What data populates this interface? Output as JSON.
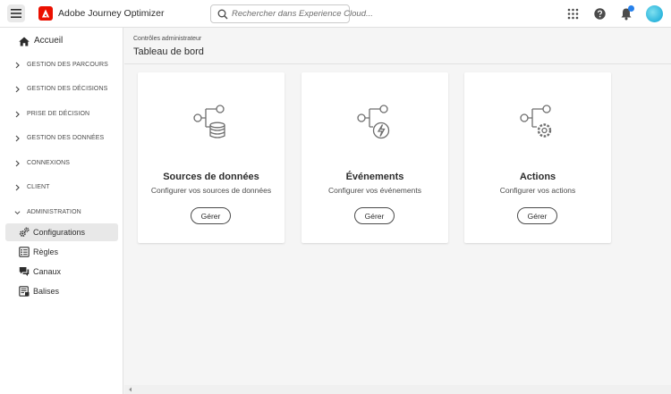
{
  "header": {
    "app_title": "Adobe Journey Optimizer",
    "search_placeholder": "Rechercher dans Experience Cloud...",
    "icons": [
      "menu-icon",
      "adobe-logo",
      "search-icon",
      "apps-grid-icon",
      "help-icon",
      "bell-icon",
      "avatar"
    ],
    "accent_color": "#eb1000"
  },
  "sidebar": {
    "home": "Accueil",
    "sections": [
      {
        "label": "GESTION DES PARCOURS",
        "expanded": false
      },
      {
        "label": "GESTION DES DÉCISIONS",
        "expanded": false
      },
      {
        "label": "PRISE DE DÉCISION",
        "expanded": false
      },
      {
        "label": "GESTION DES DONNÉES",
        "expanded": false
      },
      {
        "label": "CONNEXIONS",
        "expanded": false
      },
      {
        "label": "CLIENT",
        "expanded": false
      },
      {
        "label": "ADMINISTRATION",
        "expanded": true
      }
    ],
    "admin_items": [
      {
        "label": "Configurations",
        "icon": "gears-icon",
        "active": true
      },
      {
        "label": "Règles",
        "icon": "rules-list-icon",
        "active": false
      },
      {
        "label": "Canaux",
        "icon": "channels-icon",
        "active": false
      },
      {
        "label": "Balises",
        "icon": "tags-list-icon",
        "active": false
      }
    ]
  },
  "main": {
    "breadcrumb": "Contrôles administrateur",
    "title": "Tableau de bord",
    "cards": [
      {
        "title": "Sources de données",
        "description": "Configurer vos sources de données",
        "button": "Gérer",
        "icon": "data-sources-icon"
      },
      {
        "title": "Événements",
        "description": "Configurer vos événements",
        "button": "Gérer",
        "icon": "events-icon"
      },
      {
        "title": "Actions",
        "description": "Configurer vos actions",
        "button": "Gérer",
        "icon": "actions-icon"
      }
    ]
  }
}
